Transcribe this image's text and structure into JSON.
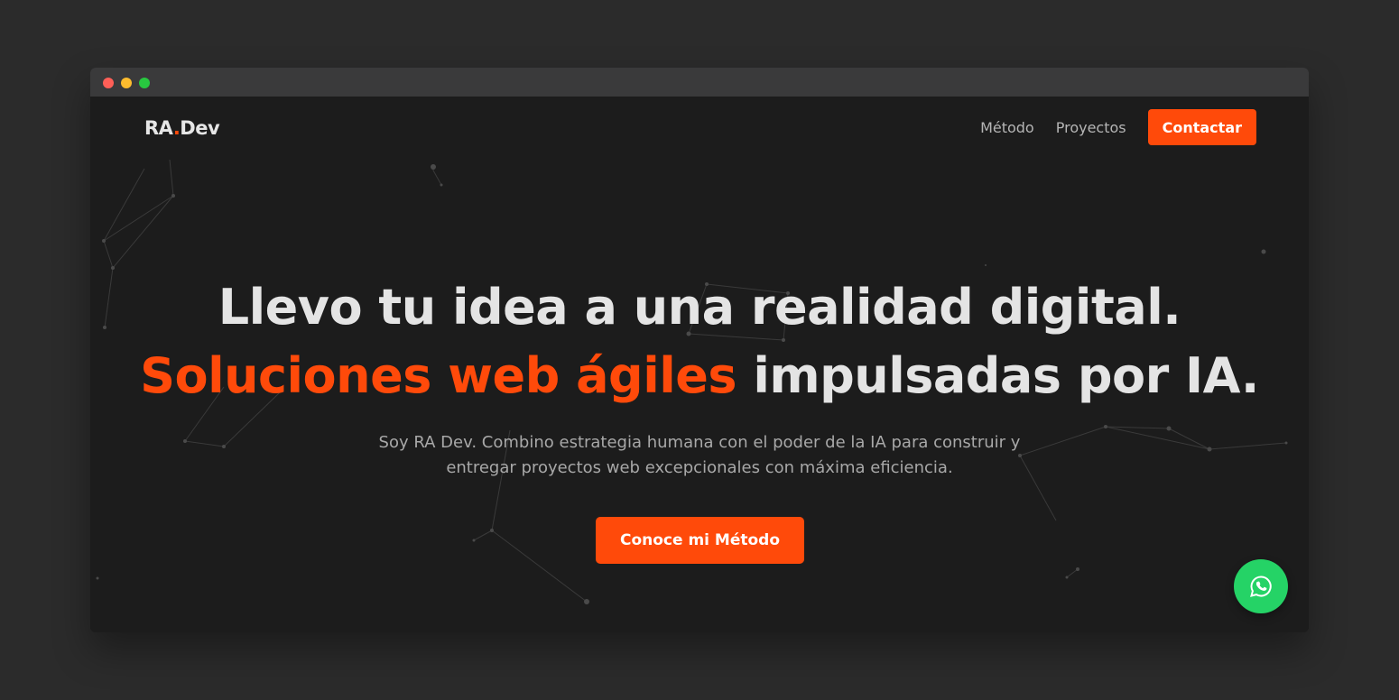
{
  "brand": {
    "logo_prefix": "RA",
    "logo_dot": ".",
    "logo_suffix": "Dev",
    "accent_color": "#ff4a0a"
  },
  "nav": {
    "links": [
      {
        "label": "Método"
      },
      {
        "label": "Proyectos"
      }
    ],
    "contact_label": "Contactar"
  },
  "hero": {
    "headline_line1": "Llevo tu idea a una realidad digital.",
    "headline_accent": "Soluciones web ágiles",
    "headline_rest": "impulsadas por IA.",
    "subtitle_line1": "Soy RA Dev. Combino estrategia humana con el poder de la IA para construir y",
    "subtitle_line2": "entregar proyectos web excepcionales con máxima eficiencia.",
    "cta_label": "Conoce mi Método"
  },
  "floating": {
    "whatsapp_icon": "whatsapp-icon",
    "whatsapp_color": "#25d366"
  },
  "window": {
    "controls": [
      "close",
      "minimize",
      "maximize"
    ]
  }
}
